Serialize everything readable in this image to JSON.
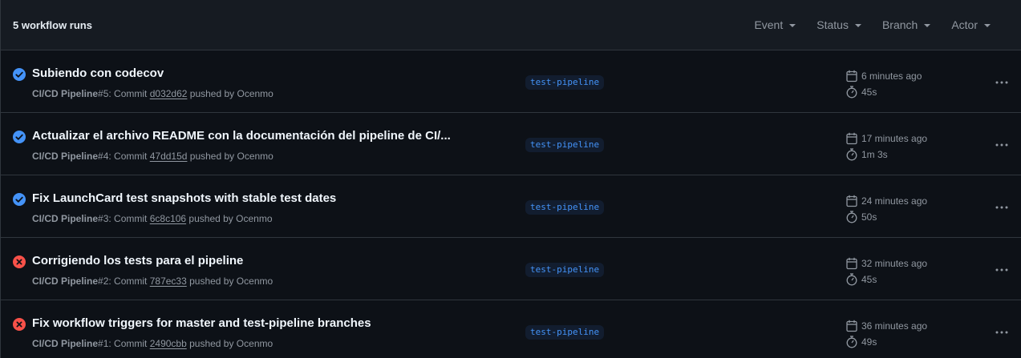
{
  "header": {
    "title": "5 workflow runs",
    "filters": [
      {
        "label": "Event"
      },
      {
        "label": "Status"
      },
      {
        "label": "Branch"
      },
      {
        "label": "Actor"
      }
    ]
  },
  "colors": {
    "success": "#4493f8",
    "failure": "#f85149",
    "branch": "#4493f8"
  },
  "runs": [
    {
      "status": "success",
      "status_icon": "check-circle-icon",
      "title": "Subiendo con codecov",
      "workflow": "CI/CD Pipeline",
      "run_number": "#5",
      "commit_prefix": ": Commit ",
      "sha": "d032d62",
      "pushed_by": " pushed by Ocenmo",
      "branch": "test-pipeline",
      "time_ago": "6 minutes ago",
      "duration": "45s"
    },
    {
      "status": "success",
      "status_icon": "check-circle-icon",
      "title": "Actualizar el archivo README con la documentación del pipeline de CI/...",
      "workflow": "CI/CD Pipeline",
      "run_number": "#4",
      "commit_prefix": ": Commit ",
      "sha": "47dd15d",
      "pushed_by": " pushed by Ocenmo",
      "branch": "test-pipeline",
      "time_ago": "17 minutes ago",
      "duration": "1m 3s"
    },
    {
      "status": "success",
      "status_icon": "check-circle-icon",
      "title": "Fix LaunchCard test snapshots with stable test dates",
      "workflow": "CI/CD Pipeline",
      "run_number": "#3",
      "commit_prefix": ": Commit ",
      "sha": "6c8c106",
      "pushed_by": " pushed by Ocenmo",
      "branch": "test-pipeline",
      "time_ago": "24 minutes ago",
      "duration": "50s"
    },
    {
      "status": "failure",
      "status_icon": "x-circle-icon",
      "title": "Corrigiendo los tests para el pipeline",
      "workflow": "CI/CD Pipeline",
      "run_number": "#2",
      "commit_prefix": ": Commit ",
      "sha": "787ec33",
      "pushed_by": " pushed by Ocenmo",
      "branch": "test-pipeline",
      "time_ago": "32 minutes ago",
      "duration": "45s"
    },
    {
      "status": "failure",
      "status_icon": "x-circle-icon",
      "title": "Fix workflow triggers for master and test-pipeline branches",
      "workflow": "CI/CD Pipeline",
      "run_number": "#1",
      "commit_prefix": ": Commit ",
      "sha": "2490cbb",
      "pushed_by": " pushed by Ocenmo",
      "branch": "test-pipeline",
      "time_ago": "36 minutes ago",
      "duration": "49s"
    }
  ]
}
